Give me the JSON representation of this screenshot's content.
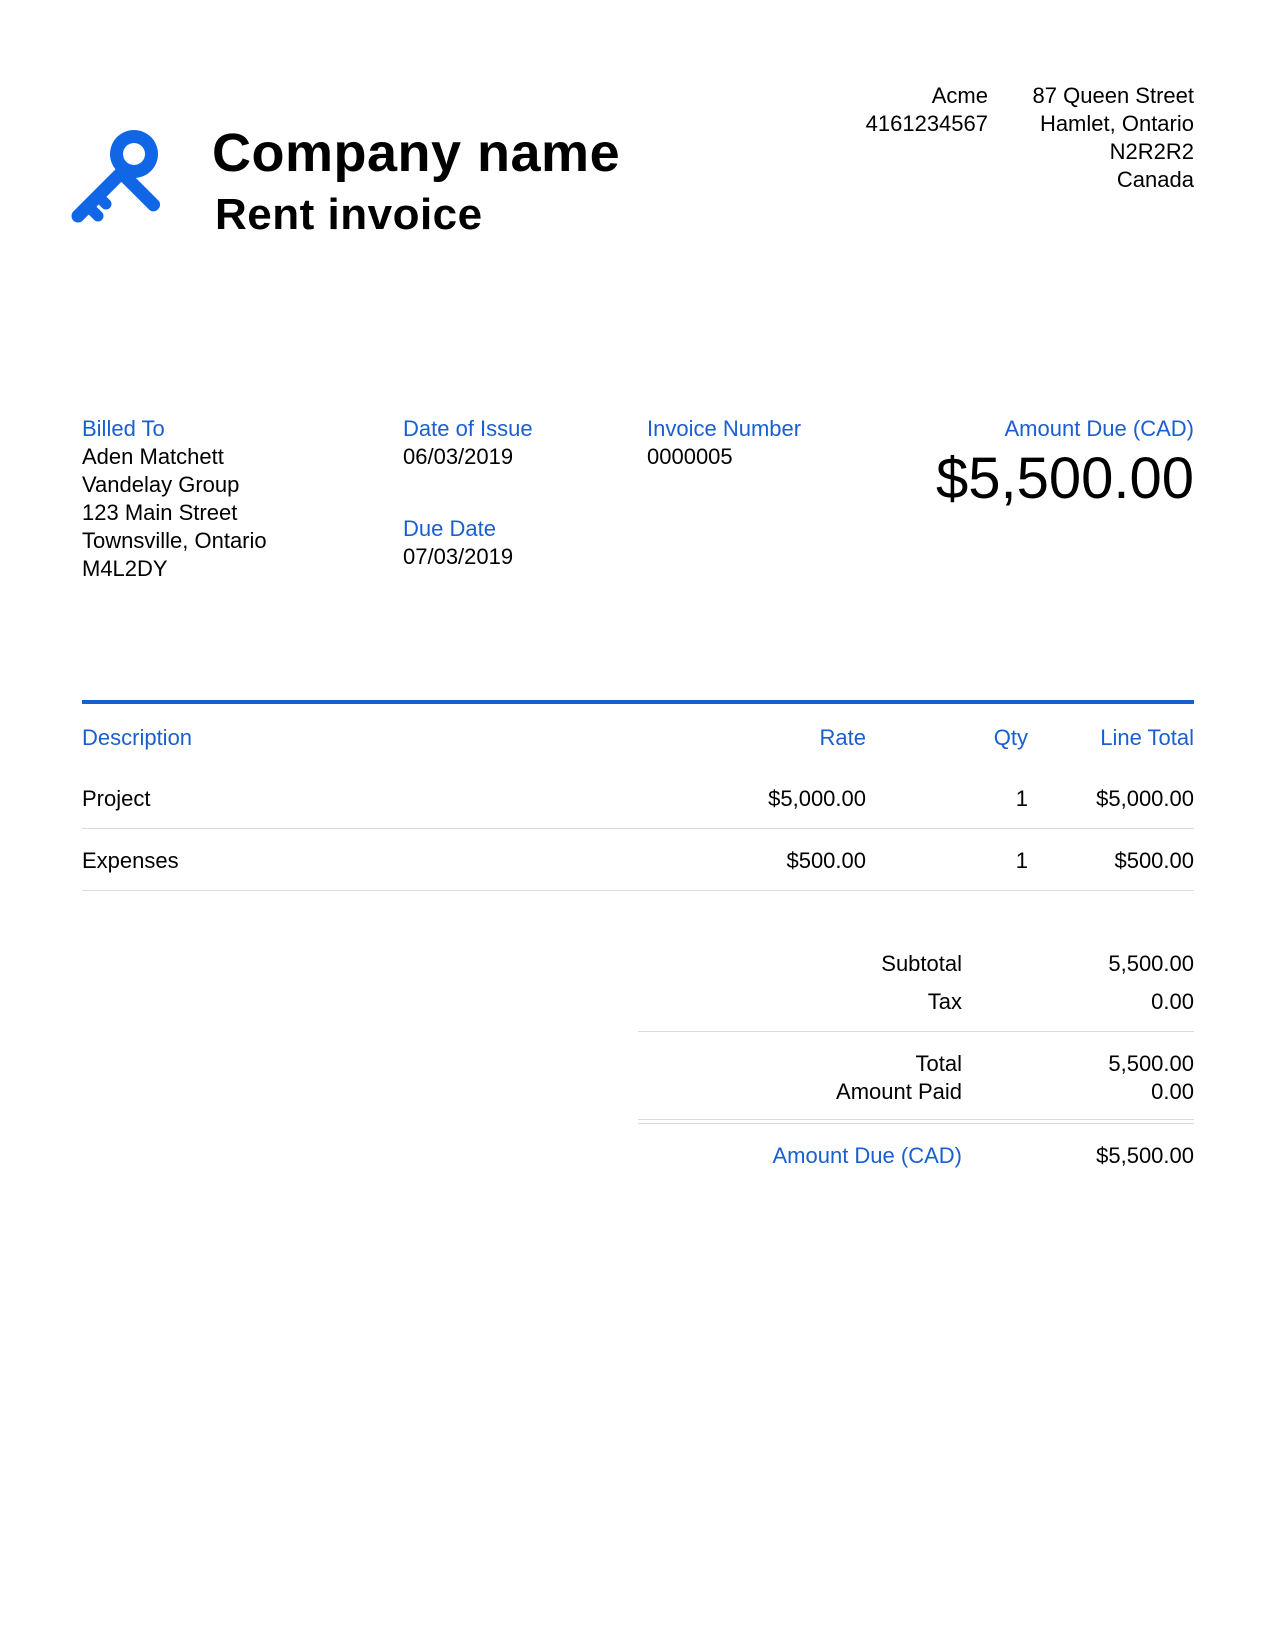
{
  "header": {
    "logo_icon": "key-icon",
    "company_name": "Company name",
    "document_title": "Rent invoice",
    "accent_color": "#1a5fd0"
  },
  "sender": {
    "name": "Acme",
    "phone": "4161234567",
    "address_lines": [
      "87 Queen Street",
      "Hamlet, Ontario",
      "N2R2R2",
      "Canada"
    ]
  },
  "billed_to": {
    "label": "Billed To",
    "lines": [
      "Aden Matchett",
      "Vandelay Group",
      "123 Main Street",
      "Townsville, Ontario",
      "M4L2DY"
    ]
  },
  "date_of_issue": {
    "label": "Date of Issue",
    "value": "06/03/2019"
  },
  "due_date": {
    "label": "Due Date",
    "value": "07/03/2019"
  },
  "invoice_number": {
    "label": "Invoice Number",
    "value": "0000005"
  },
  "amount_due": {
    "label": "Amount Due (CAD)",
    "value": "$5,500.00"
  },
  "items": {
    "headers": {
      "description": "Description",
      "rate": "Rate",
      "qty": "Qty",
      "line_total": "Line Total"
    },
    "rows": [
      {
        "description": "Project",
        "rate": "$5,000.00",
        "qty": "1",
        "line_total": "$5,000.00"
      },
      {
        "description": "Expenses",
        "rate": "$500.00",
        "qty": "1",
        "line_total": "$500.00"
      }
    ]
  },
  "totals": {
    "subtotal": {
      "label": "Subtotal",
      "value": "5,500.00"
    },
    "tax": {
      "label": "Tax",
      "value": "0.00"
    },
    "total": {
      "label": "Total",
      "value": "5,500.00"
    },
    "amount_paid": {
      "label": "Amount Paid",
      "value": "0.00"
    },
    "amount_due": {
      "label": "Amount Due (CAD)",
      "value": "$5,500.00"
    }
  }
}
